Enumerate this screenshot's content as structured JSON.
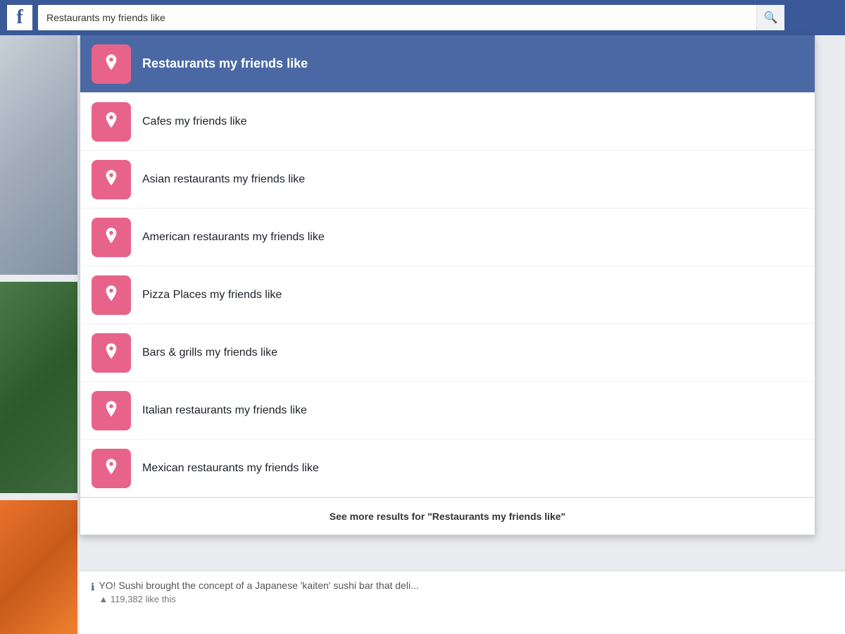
{
  "topbar": {
    "logo": "f",
    "search_value": "Restaurants my friends like",
    "search_icon": "🔍"
  },
  "dropdown": {
    "items": [
      {
        "id": 0,
        "label": "Restaurants my friends like",
        "selected": true
      },
      {
        "id": 1,
        "label": "Cafes my friends like",
        "selected": false
      },
      {
        "id": 2,
        "label": "Asian restaurants my friends like",
        "selected": false
      },
      {
        "id": 3,
        "label": "American restaurants my friends like",
        "selected": false
      },
      {
        "id": 4,
        "label": "Pizza Places my friends like",
        "selected": false
      },
      {
        "id": 5,
        "label": "Bars & grills my friends like",
        "selected": false
      },
      {
        "id": 6,
        "label": "Italian restaurants my friends like",
        "selected": false
      },
      {
        "id": 7,
        "label": "Mexican restaurants my friends like",
        "selected": false
      }
    ],
    "see_more_label": "See more results for \"Restaurants my friends like\""
  },
  "bottom": {
    "info_text": "YO! Sushi brought the concept of a Japanese 'kaiten' sushi bar that deli...",
    "likes_text": "▲ 119,382 like this"
  }
}
